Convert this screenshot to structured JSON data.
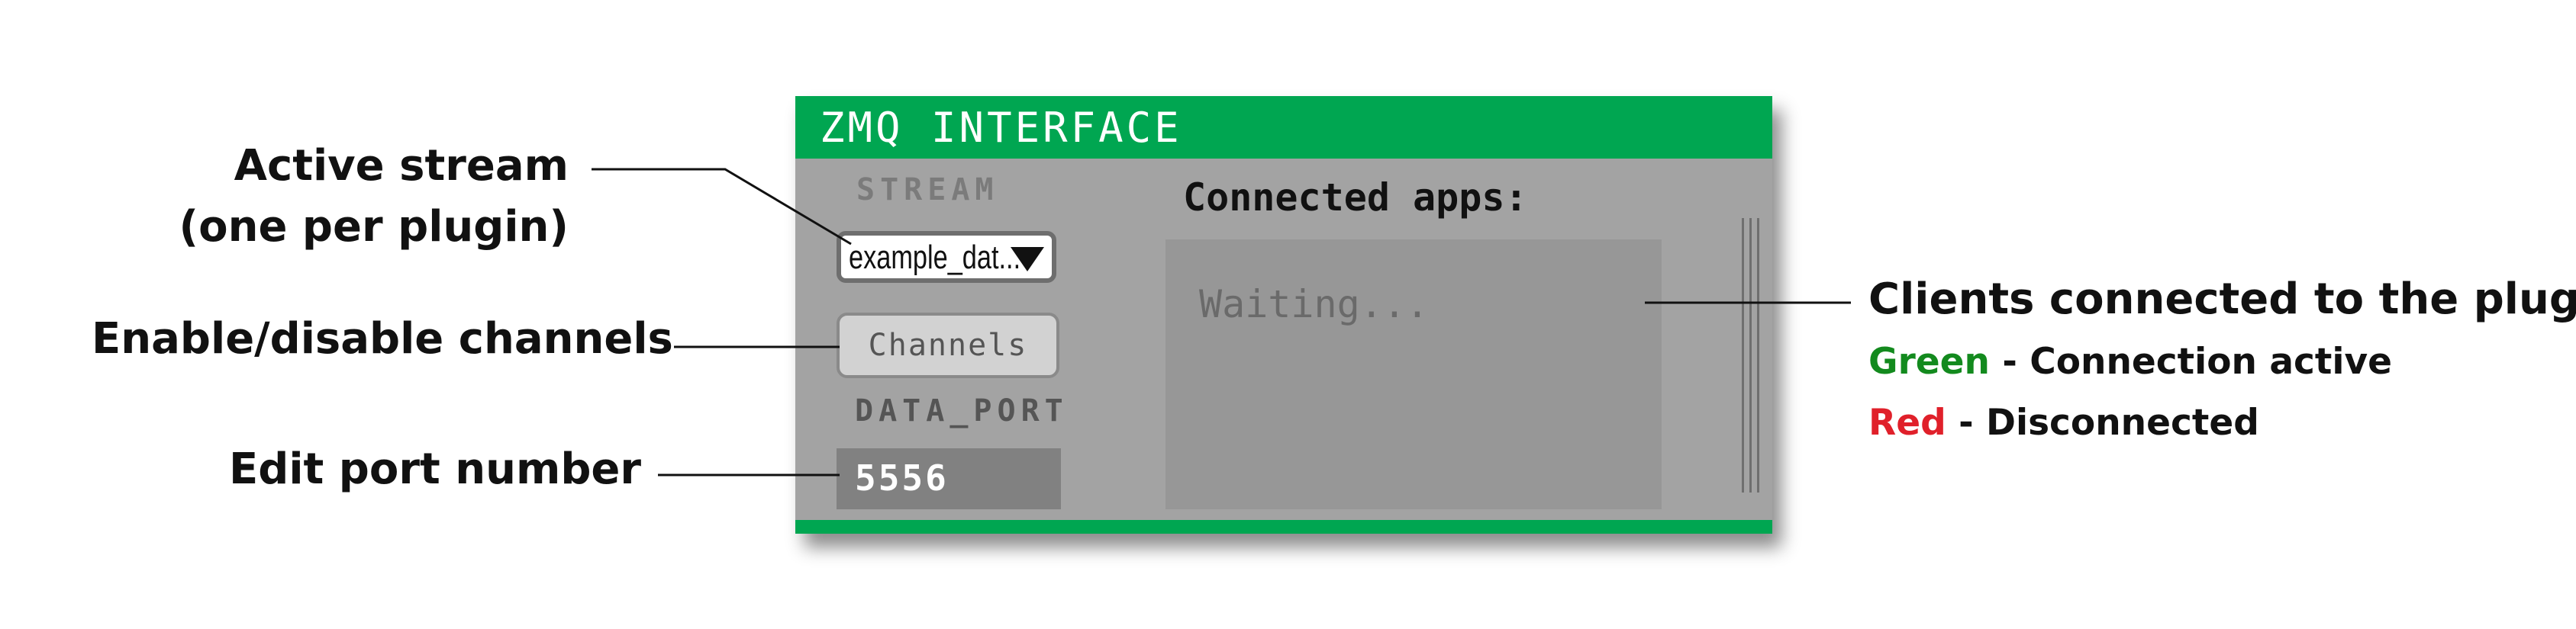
{
  "annotations": {
    "active_stream": [
      "Active stream",
      "(one per plugin)"
    ],
    "enable_channels": "Enable/disable channels",
    "edit_port": "Edit port number",
    "clients_connected": "Clients connected to the plugin",
    "legend": {
      "green_word": "Green",
      "green_text": " - Connection active",
      "red_word": "Red",
      "red_text": " - Disconnected"
    }
  },
  "panel": {
    "title": "ZMQ INTERFACE",
    "stream_label": "STREAM",
    "stream_value": "example_dat...",
    "channels_button": "Channels",
    "data_port_label": "DATA_PORT",
    "port_value": "5556",
    "connected_label": "Connected apps:",
    "connected_status": "Waiting...",
    "dropdown_icon": "triangle-down-icon"
  },
  "colors": {
    "header": "#00a651",
    "panel_bg": "#a3a3a3",
    "legend_green": "#138a1e",
    "legend_red": "#e0202a"
  }
}
